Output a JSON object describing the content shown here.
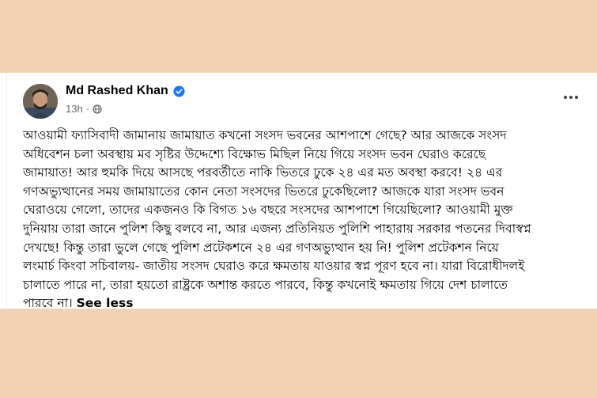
{
  "post": {
    "author": "Md Rashed Khan",
    "time": "13h",
    "more_icon": "more-horizontal-icon",
    "verified_icon": "verified-badge-icon",
    "privacy_icon": "globe-icon",
    "lines": [
      "আওয়ামী ফ্যাসিবাদী জামানায় জামায়াত কখনো সংসদ ভবনের আশপাশে গেছে? আর আজকে সংসদ",
      "অধিবেশন চলা অবস্থায় মব সৃষ্টির উদ্দেশ্যে বিক্ষোভ মিছিল নিয়ে গিয়ে সংসদ ভবন ঘেরাও করেছে",
      "জামায়াত! আর হুমকি দিয়ে আসছে পরবর্তীতে নাকি ভিতরে ঢুকে ২৪ এর মত অবস্থা করবে! ২৪  এর",
      "গণঅভ্যুত্থানের সময় জামায়াতের কোন নেতা সংসদের ভিতরে ঢুকেছিলো? আজকে যারা সংসদ ভবন",
      "ঘেরাওয়ে গেলো, তাদের একজনও কি বিগত ১৬ বছরে সংসদের আশপাশে গিয়েছিলো? আওয়ামী মুক্ত",
      "দুনিয়ায় তারা জানে পুলিশ কিছু বলবে না, আর এজন্য প্রতিনিয়ত পুলিশি পাহারায় সরকার পতনের দিবাস্বপ্ন",
      "দেখছে! কিন্তু তারা ভুলে গেছে পুলিশ প্রটেকশনে ২৪ এর গণঅভ্যুত্থান হয় নি! পুলিশ প্রটেকশন নিয়ে",
      "লংমার্চ কিংবা সচিবালয়- জাতীয় সংসদ ঘেরাও করে ক্ষমতায় যাওয়ার স্বপ্ন পূরণ হবে না। যারা বিরোধীদলই",
      "চালাতে পারে না, তারা হয়তো রাষ্ট্রকে অশান্ত করতে পারবে, কিন্তু কখনোই ক্ষমতায় গিয়ে দেশ চালাতে",
      "পারবে না।"
    ],
    "see_less": "See less"
  }
}
